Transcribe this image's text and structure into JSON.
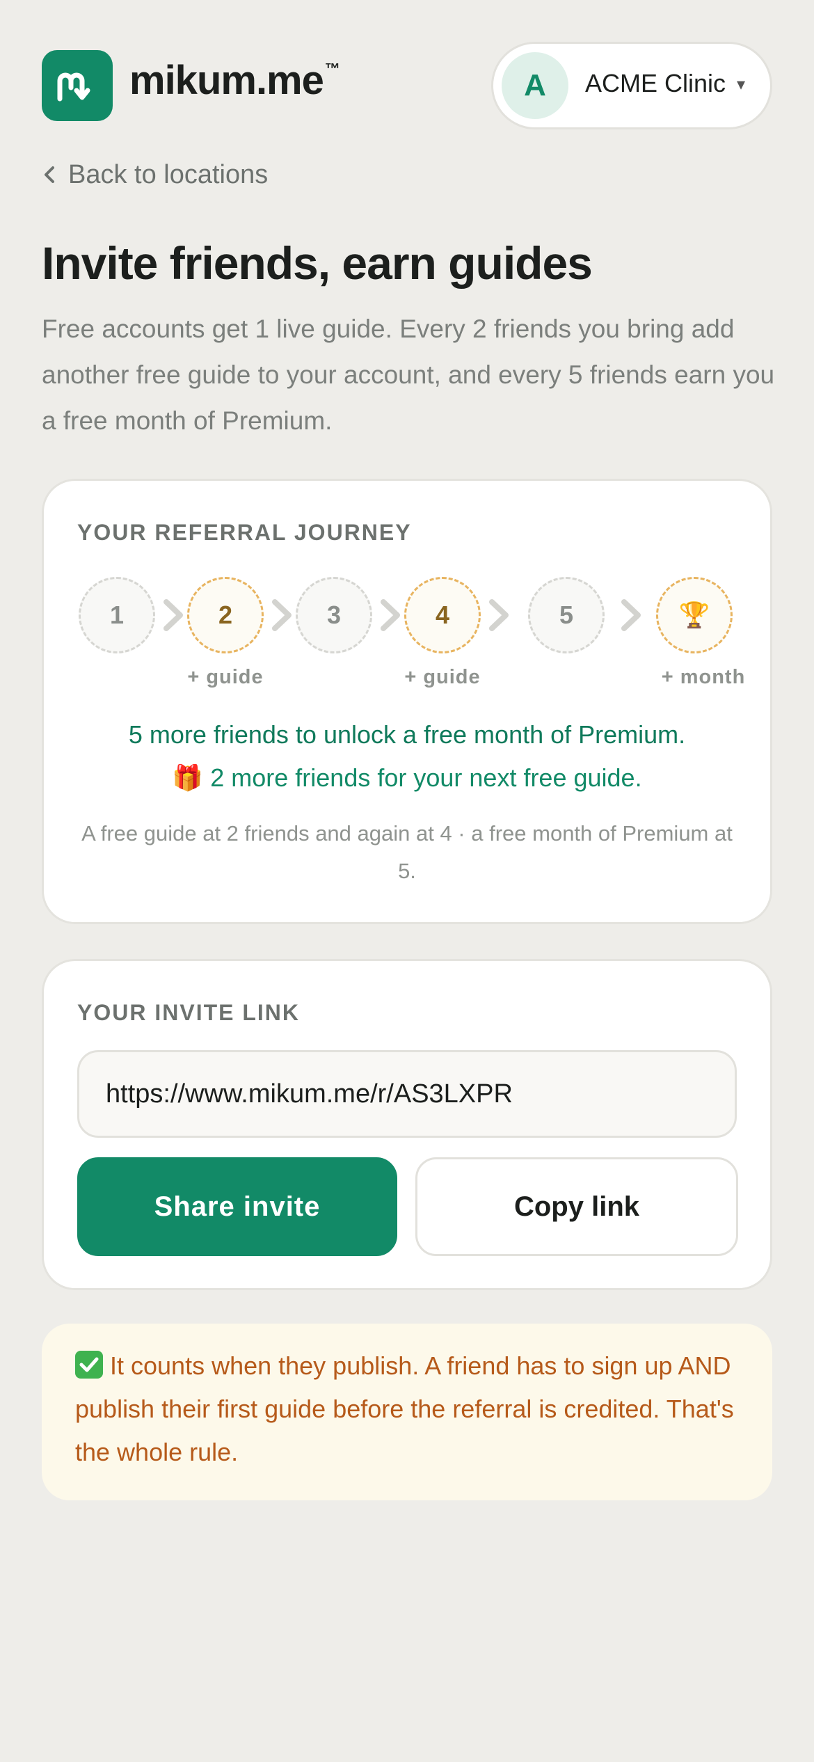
{
  "header": {
    "brand": "mikum.me",
    "trademark": "™",
    "clinic": {
      "initial": "A",
      "name": "ACME Clinic",
      "caret": "▾"
    }
  },
  "back_label": "Back to locations",
  "title": "Invite friends, earn guides",
  "intro": "Free accounts get 1 live guide. Every 2 friends you bring add another free guide to your account, and every 5 friends earn you a free month of Premium.",
  "journey": {
    "label": "YOUR REFERRAL JOURNEY",
    "steps": [
      {
        "label": "1",
        "reward": "",
        "highlight": false
      },
      {
        "label": "2",
        "reward": "+ guide",
        "highlight": true
      },
      {
        "label": "3",
        "reward": "",
        "highlight": false
      },
      {
        "label": "4",
        "reward": "+ guide",
        "highlight": true
      },
      {
        "label": "5",
        "reward": "",
        "highlight": false
      },
      {
        "label": "🏆",
        "reward": "+ month",
        "highlight": true
      }
    ],
    "status_primary": "5 more friends to unlock a free month of Premium.",
    "status_secondary_icon": "🎁",
    "status_secondary": "2 more friends for your next free guide.",
    "footnote": "A free guide at 2 friends and again at 4 · a free month of Premium at 5."
  },
  "invite": {
    "label": "YOUR INVITE LINK",
    "url": "https://www.mikum.me/r/AS3LXPR",
    "share_label": "Share invite",
    "copy_label": "Copy link"
  },
  "notice": {
    "text": "It counts when they publish. A friend has to sign up AND publish their first guide before the referral is credited. That's the whole rule."
  },
  "colors": {
    "brand": "#128a67",
    "background": "#eeede9",
    "highlight_ring": "#e8b460",
    "notice_text": "#b65a1a",
    "notice_bg": "#fdf9ea"
  },
  "icons": {
    "logo": "mikum-logo-icon",
    "back": "chevron-left-icon",
    "step_arrow": "chevron-right-icon",
    "notice": "check-box-icon"
  }
}
